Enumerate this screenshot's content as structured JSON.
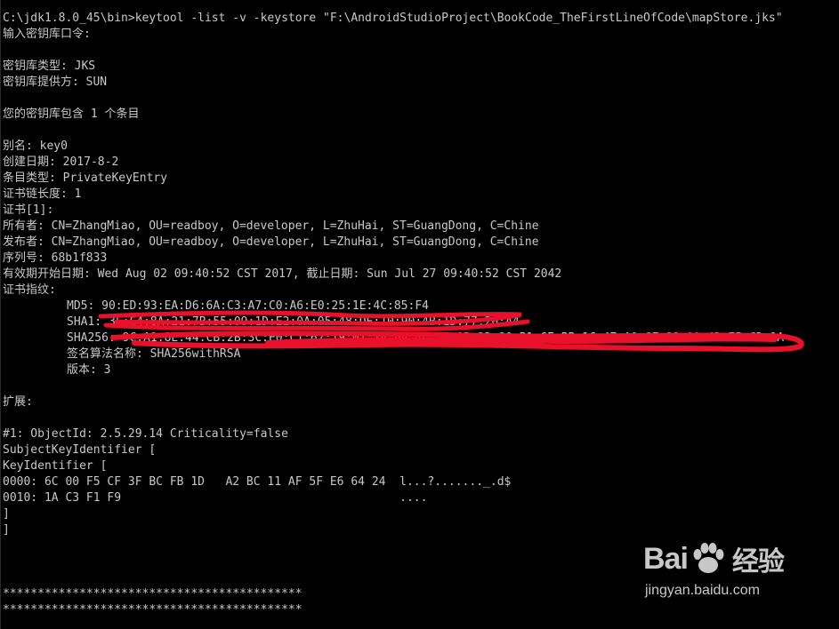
{
  "terminal": {
    "lines": [
      "C:\\jdk1.8.0_45\\bin>keytool -list -v -keystore \"F:\\AndroidStudioProject\\BookCode_TheFirstLineOfCode\\mapStore.jks\"",
      "输入密钥库口令:",
      "",
      "密钥库类型: JKS",
      "密钥库提供方: SUN",
      "",
      "您的密钥库包含 1 个条目",
      "",
      "别名: key0",
      "创建日期: 2017-8-2",
      "条目类型: PrivateKeyEntry",
      "证书链长度: 1",
      "证书[1]:",
      "所有者: CN=ZhangMiao, OU=readboy, O=developer, L=ZhuHai, ST=GuangDong, C=Chine",
      "发布者: CN=ZhangMiao, OU=readboy, O=developer, L=ZhuHai, ST=GuangDong, C=Chine",
      "序列号: 68b1f833",
      "有效期开始日期: Wed Aug 02 09:40:52 CST 2017, 截止日期: Sun Jul 27 09:40:52 CST 2042",
      "证书指纹:",
      "MD5: 90:ED:93:EA:D6:6A:C3:A7:C0:A6:E0:25:1E:4C:85:F4",
      "SHA1: 3F:C4:8A:21:7B:55:09:1D:E2:0A:05:48:DE:10:90:4B:1D:77:20:A4",
      "SHA256: 9C:A1:8E:44:CB:2B:3C:E0:C1:62:19:01:7A:88:4E:55:1B:2D:90:B1:6F:BB:1C:47:A0:6F:98:00:4D:75:CD:1A",
      "签名算法名称: SHA256withRSA",
      "版本: 3",
      "",
      "扩展:",
      "",
      "#1: ObjectId: 2.5.29.14 Criticality=false",
      "SubjectKeyIdentifier [",
      "KeyIdentifier [",
      "0000: 6C 00 F5 CF 3F BC FB 1D   A2 BC 11 AF 5F E6 64 24  l...?......._.d$",
      "0010: 1A C3 F1 F9                                        ....",
      "]",
      "]",
      "",
      "",
      "",
      "*******************************************",
      "*******************************************"
    ],
    "indented_lines": [
      18,
      19,
      20,
      21,
      22
    ]
  },
  "watermark": {
    "brand_left": "Bai",
    "brand_right": "经验",
    "url": "jingyan.baidu.com"
  },
  "colors": {
    "background": "#000000",
    "text": "#c8c8c8",
    "redaction": "#e8102a"
  }
}
